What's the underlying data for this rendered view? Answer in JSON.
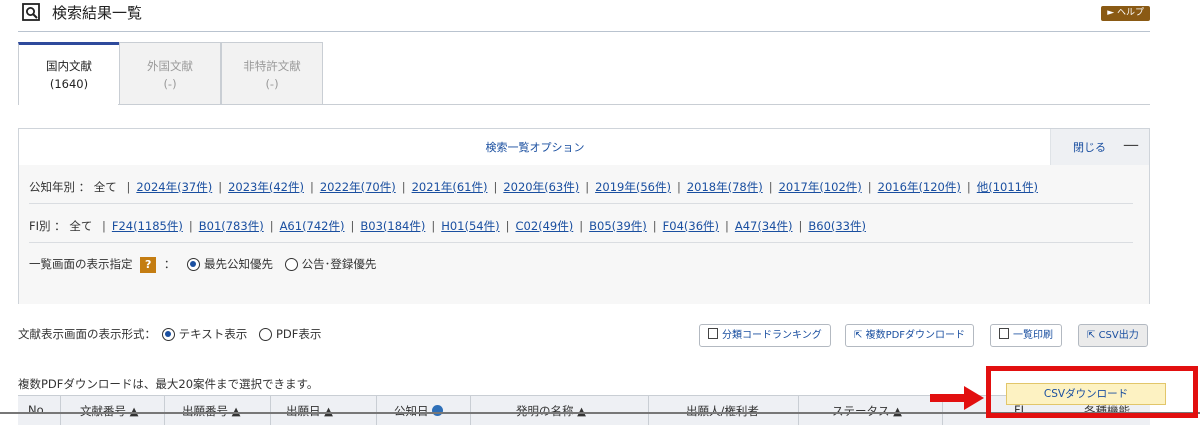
{
  "header": {
    "title": "検索結果一覧",
    "help_label": "► ヘルプ"
  },
  "tabs": [
    {
      "label": "国内文献",
      "count": "(1640)",
      "active": true
    },
    {
      "label": "外国文献",
      "count": "(-)",
      "active": false
    },
    {
      "label": "非特許文献",
      "count": "(-)",
      "active": false
    }
  ],
  "options": {
    "title": "検索一覧オプション",
    "close_label": "閉じる",
    "collapse_symbol": "—",
    "year_filter": {
      "label": "公知年別 ： 全て",
      "items": [
        "2024年(37件)",
        "2023年(42件)",
        "2022年(70件)",
        "2021年(61件)",
        "2020年(63件)",
        "2019年(56件)",
        "2018年(78件)",
        "2017年(102件)",
        "2016年(120件)",
        "他(1011件)"
      ]
    },
    "fi_filter": {
      "label": "FI別 ： 全て",
      "items": [
        "F24(1185件)",
        "B01(783件)",
        "A61(742件)",
        "B03(184件)",
        "H01(54件)",
        "C02(49件)",
        "B05(39件)",
        "F04(36件)",
        "A47(34件)",
        "B60(33件)"
      ]
    },
    "display_pref": {
      "label": "一覧画面の表示指定",
      "help": "?",
      "colon": "：",
      "options": [
        "最先公知優先",
        "公告･登録優先"
      ],
      "selected": 0
    }
  },
  "format": {
    "label": "文献表示画面の表示形式：",
    "options": [
      "テキスト表示",
      "PDF表示"
    ],
    "selected": 0
  },
  "actions": {
    "ranking": "分類コードランキング",
    "multi_pdf": "複数PDFダウンロード",
    "print": "一覧印刷",
    "csv": "CSV出力"
  },
  "note": "複数PDFダウンロードは、最大20案件まで選択できます。",
  "table": {
    "columns": [
      "No.",
      "文献番号 ▲",
      "出願番号 ▲",
      "出願日 ▲",
      "公知日",
      "発明の名称 ▲",
      "出願人/権利者",
      "ステータス ▲",
      "FI",
      "各種機能"
    ]
  },
  "popup": {
    "csv_download": "CSVダウンロード"
  }
}
